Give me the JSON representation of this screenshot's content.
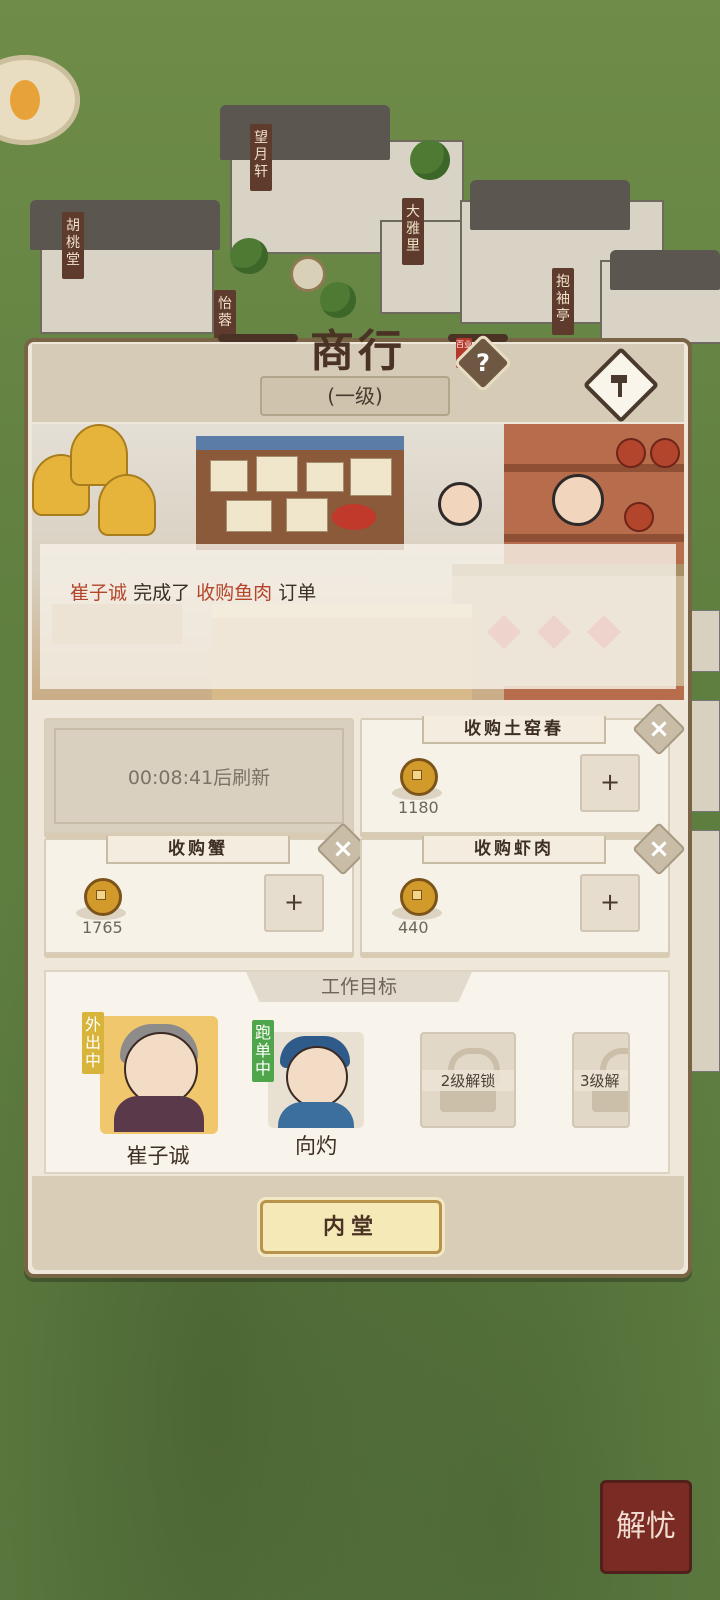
{
  "map": {
    "signs": [
      "胡桃堂",
      "望月轩",
      "大雅里",
      "抱袖亭",
      "怡蓉"
    ],
    "jieyou_label": "解忧"
  },
  "panel": {
    "title": "商行",
    "seal": "百业",
    "help": "?",
    "level": "(一级)"
  },
  "toast": {
    "name": "崔子诚",
    "action": "完成了",
    "order": "收购鱼肉",
    "suffix": "订单"
  },
  "orders": {
    "refresh_text": "00:08:41后刷新",
    "slots": [
      {
        "label": "收购土窑春",
        "amount": "1180"
      },
      {
        "label": "收购蟹",
        "amount": "1765"
      },
      {
        "label": "收购虾肉",
        "amount": "440"
      }
    ],
    "plus": "+",
    "close": "×"
  },
  "goals": {
    "title": "工作目标",
    "workers": [
      {
        "name": "崔子诚",
        "status": "外出中",
        "status_color": "#d9b43a"
      },
      {
        "name": "向灼",
        "status": "跑单中",
        "status_color": "#4fa64a"
      }
    ],
    "locked": [
      "2级解锁",
      "3级解"
    ]
  },
  "inner_button": "内堂"
}
